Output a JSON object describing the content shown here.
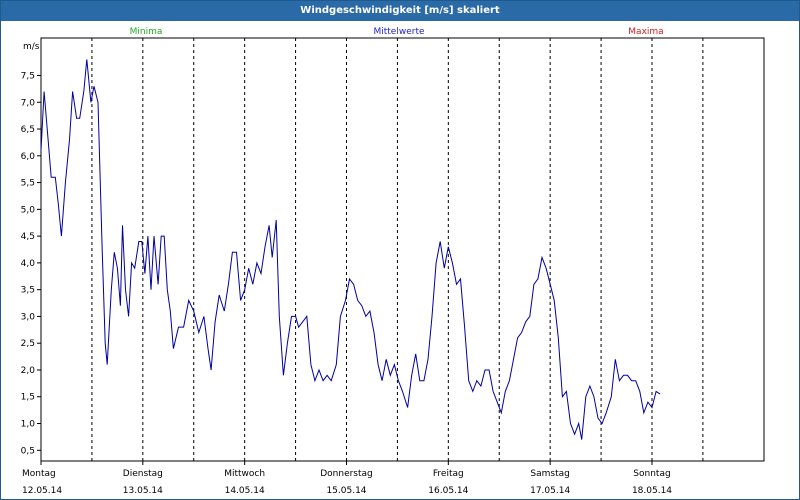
{
  "window": {
    "title": "Windgeschwindigkeit [m/s] skaliert"
  },
  "chart_data": {
    "type": "line",
    "ylabel": "m/s",
    "ylim": [
      0.3,
      8.2
    ],
    "yticks": [
      "7,5",
      "7,0",
      "6,5",
      "6,0",
      "5,5",
      "5,0",
      "4,5",
      "4,0",
      "3,5",
      "3,0",
      "2,5",
      "2,0",
      "1,5",
      "1,0",
      "0,5"
    ],
    "ytick_values": [
      7.5,
      7.0,
      6.5,
      6.0,
      5.5,
      5.0,
      4.5,
      4.0,
      3.5,
      3.0,
      2.5,
      2.0,
      1.5,
      1.0,
      0.5
    ],
    "xlim": [
      0,
      7.1
    ],
    "days": [
      {
        "day": "Montag",
        "date": "12.05.14"
      },
      {
        "day": "Dienstag",
        "date": "13.05.14"
      },
      {
        "day": "Mittwoch",
        "date": "14.05.14"
      },
      {
        "day": "Donnerstag",
        "date": "15.05.14"
      },
      {
        "day": "Freitag",
        "date": "16.05.14"
      },
      {
        "day": "Samstag",
        "date": "17.05.14"
      },
      {
        "day": "Sonntag",
        "date": "18.05.14"
      }
    ],
    "grid": true,
    "legend": [
      {
        "label": "Minima",
        "color": "#22aa22"
      },
      {
        "label": "Mittelwerte",
        "color": "#2222cc"
      },
      {
        "label": "Maxima",
        "color": "#cc2222"
      }
    ],
    "series": [
      {
        "color": "#0000a0",
        "points": [
          [
            0.0,
            6.1
          ],
          [
            0.03,
            7.2
          ],
          [
            0.07,
            6.3
          ],
          [
            0.1,
            5.6
          ],
          [
            0.14,
            5.6
          ],
          [
            0.17,
            5.1
          ],
          [
            0.2,
            4.5
          ],
          [
            0.24,
            5.5
          ],
          [
            0.28,
            6.3
          ],
          [
            0.31,
            7.2
          ],
          [
            0.35,
            6.7
          ],
          [
            0.38,
            6.7
          ],
          [
            0.42,
            7.2
          ],
          [
            0.45,
            7.8
          ],
          [
            0.49,
            7.0
          ],
          [
            0.52,
            7.3
          ],
          [
            0.56,
            7.0
          ],
          [
            0.6,
            4.3
          ],
          [
            0.63,
            2.5
          ],
          [
            0.65,
            2.1
          ],
          [
            0.69,
            3.5
          ],
          [
            0.72,
            4.2
          ],
          [
            0.75,
            3.9
          ],
          [
            0.78,
            3.2
          ],
          [
            0.8,
            4.7
          ],
          [
            0.83,
            3.5
          ],
          [
            0.86,
            3.0
          ],
          [
            0.89,
            4.0
          ],
          [
            0.92,
            3.9
          ],
          [
            0.96,
            4.4
          ],
          [
            0.99,
            4.4
          ],
          [
            1.02,
            3.8
          ],
          [
            1.05,
            4.5
          ],
          [
            1.08,
            3.5
          ],
          [
            1.11,
            4.5
          ],
          [
            1.15,
            3.6
          ],
          [
            1.18,
            4.5
          ],
          [
            1.21,
            4.5
          ],
          [
            1.24,
            3.5
          ],
          [
            1.27,
            3.1
          ],
          [
            1.3,
            2.4
          ],
          [
            1.35,
            2.8
          ],
          [
            1.4,
            2.8
          ],
          [
            1.45,
            3.3
          ],
          [
            1.5,
            3.1
          ],
          [
            1.55,
            2.7
          ],
          [
            1.6,
            3.0
          ],
          [
            1.64,
            2.4
          ],
          [
            1.67,
            2.0
          ],
          [
            1.71,
            2.9
          ],
          [
            1.75,
            3.4
          ],
          [
            1.8,
            3.1
          ],
          [
            1.84,
            3.6
          ],
          [
            1.88,
            4.2
          ],
          [
            1.92,
            4.2
          ],
          [
            1.96,
            3.3
          ],
          [
            2.0,
            3.5
          ],
          [
            2.04,
            3.9
          ],
          [
            2.08,
            3.6
          ],
          [
            2.12,
            4.0
          ],
          [
            2.16,
            3.8
          ],
          [
            2.2,
            4.3
          ],
          [
            2.24,
            4.7
          ],
          [
            2.27,
            4.1
          ],
          [
            2.31,
            4.8
          ],
          [
            2.34,
            3.0
          ],
          [
            2.38,
            1.9
          ],
          [
            2.42,
            2.5
          ],
          [
            2.46,
            3.0
          ],
          [
            2.5,
            3.0
          ],
          [
            2.53,
            2.8
          ],
          [
            2.57,
            2.9
          ],
          [
            2.61,
            3.0
          ],
          [
            2.65,
            2.1
          ],
          [
            2.69,
            1.8
          ],
          [
            2.73,
            2.0
          ],
          [
            2.77,
            1.8
          ],
          [
            2.81,
            1.9
          ],
          [
            2.85,
            1.8
          ],
          [
            2.9,
            2.1
          ],
          [
            2.94,
            3.0
          ],
          [
            2.99,
            3.3
          ],
          [
            3.03,
            3.7
          ],
          [
            3.07,
            3.6
          ],
          [
            3.11,
            3.3
          ],
          [
            3.15,
            3.2
          ],
          [
            3.19,
            3.0
          ],
          [
            3.23,
            3.1
          ],
          [
            3.27,
            2.7
          ],
          [
            3.31,
            2.1
          ],
          [
            3.35,
            1.8
          ],
          [
            3.39,
            2.2
          ],
          [
            3.43,
            1.9
          ],
          [
            3.47,
            2.1
          ],
          [
            3.51,
            1.8
          ],
          [
            3.55,
            1.6
          ],
          [
            3.6,
            1.3
          ],
          [
            3.64,
            1.9
          ],
          [
            3.68,
            2.3
          ],
          [
            3.72,
            1.8
          ],
          [
            3.76,
            1.8
          ],
          [
            3.8,
            2.2
          ],
          [
            3.84,
            3.0
          ],
          [
            3.88,
            4.0
          ],
          [
            3.92,
            4.4
          ],
          [
            3.96,
            3.9
          ],
          [
            4.0,
            4.3
          ],
          [
            4.04,
            4.0
          ],
          [
            4.08,
            3.6
          ],
          [
            4.12,
            3.7
          ],
          [
            4.16,
            2.8
          ],
          [
            4.2,
            1.8
          ],
          [
            4.24,
            1.6
          ],
          [
            4.28,
            1.8
          ],
          [
            4.32,
            1.7
          ],
          [
            4.36,
            2.0
          ],
          [
            4.4,
            2.0
          ],
          [
            4.44,
            1.6
          ],
          [
            4.48,
            1.4
          ],
          [
            4.52,
            1.2
          ],
          [
            4.56,
            1.6
          ],
          [
            4.6,
            1.8
          ],
          [
            4.64,
            2.2
          ],
          [
            4.68,
            2.6
          ],
          [
            4.72,
            2.7
          ],
          [
            4.76,
            2.9
          ],
          [
            4.8,
            3.0
          ],
          [
            4.84,
            3.6
          ],
          [
            4.88,
            3.7
          ],
          [
            4.92,
            4.1
          ],
          [
            4.96,
            3.9
          ],
          [
            5.0,
            3.6
          ],
          [
            5.04,
            3.3
          ],
          [
            5.08,
            2.6
          ],
          [
            5.12,
            1.5
          ],
          [
            5.16,
            1.6
          ],
          [
            5.2,
            1.0
          ],
          [
            5.24,
            0.8
          ],
          [
            5.28,
            1.0
          ],
          [
            5.31,
            0.7
          ],
          [
            5.35,
            1.5
          ],
          [
            5.39,
            1.7
          ],
          [
            5.43,
            1.5
          ],
          [
            5.47,
            1.1
          ],
          [
            5.51,
            1.0
          ],
          [
            5.55,
            1.2
          ],
          [
            5.6,
            1.5
          ],
          [
            5.64,
            2.2
          ],
          [
            5.68,
            1.8
          ],
          [
            5.72,
            1.9
          ],
          [
            5.76,
            1.9
          ],
          [
            5.8,
            1.8
          ],
          [
            5.84,
            1.8
          ],
          [
            5.88,
            1.6
          ],
          [
            5.92,
            1.2
          ],
          [
            5.96,
            1.4
          ],
          [
            6.0,
            1.3
          ],
          [
            6.04,
            1.6
          ],
          [
            6.08,
            1.55
          ]
        ]
      }
    ]
  }
}
